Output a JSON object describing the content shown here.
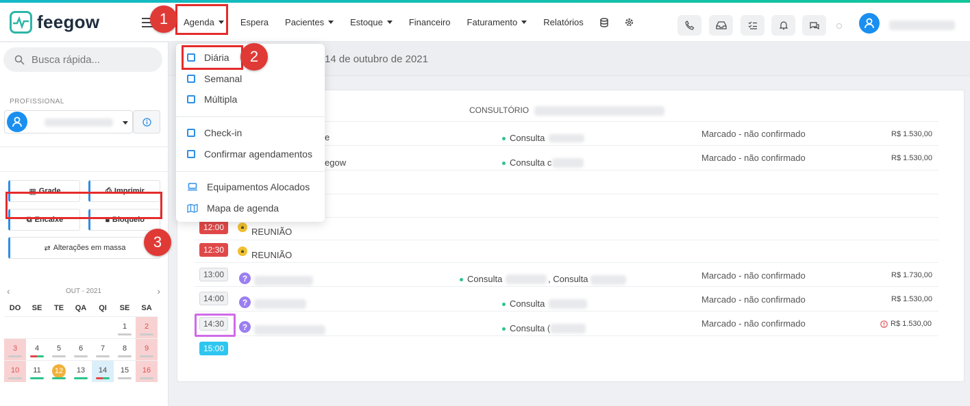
{
  "app": {
    "brand": "feegow"
  },
  "nav": {
    "agenda": "Agenda",
    "espera": "Espera",
    "pacientes": "Pacientes",
    "estoque": "Estoque",
    "financeiro": "Financeiro",
    "faturamento": "Faturamento",
    "relatorios": "Relatórios"
  },
  "badges": {
    "b1": "1",
    "b2": "2",
    "b3": "3"
  },
  "agenda_menu": {
    "items": [
      "Diária",
      "Semanal",
      "Múltipla",
      "Check-in",
      "Confirmar agendamentos",
      "Equipamentos Alocados",
      "Mapa de agenda"
    ]
  },
  "sidebar": {
    "search_placeholder": "Busca rápida...",
    "profissional_label": "PROFISSIONAL",
    "buttons": {
      "grade": "Grade",
      "imprimir": "Imprimir",
      "encaixe": "Encaixe",
      "bloqueio": "Bloqueio",
      "alteracoes": "Alterações em massa"
    }
  },
  "calendar": {
    "month": "OUT - 2021",
    "dow": [
      "DO",
      "SE",
      "TE",
      "QA",
      "QI",
      "SE",
      "SA"
    ],
    "days": [
      "",
      "",
      "",
      "",
      "1",
      "2",
      "3",
      "4",
      "5",
      "6",
      "7",
      "8",
      "9",
      "10",
      "11",
      "12",
      "13",
      "14",
      "15",
      "16"
    ]
  },
  "main": {
    "date_text": "14 de outubro de 2021",
    "room": "CONSULTÓRIO",
    "rows": [
      {
        "time": "",
        "partial_name": "e",
        "service": "Consulta",
        "status": "Marcado - não confirmado",
        "price": "R$ 1.530,00"
      },
      {
        "time": "",
        "partial_name": "egow",
        "service": "Consulta c",
        "status": "Marcado - não confirmado",
        "price": "R$ 1.530,00"
      },
      {
        "time": "12:00",
        "label": "REUNIÃO"
      },
      {
        "time": "12:30",
        "label": "REUNIÃO"
      },
      {
        "time": "13:00",
        "service": "Consulta",
        "service2": ", Consulta",
        "status": "Marcado - não confirmado",
        "price": "R$ 1.730,00"
      },
      {
        "time": "14:00",
        "service": "Consulta",
        "status": "Marcado - não confirmado",
        "price": "R$ 1.530,00"
      },
      {
        "time": "14:30",
        "service": "Consulta (",
        "status": "Marcado - não confirmado",
        "price": "R$ 1.530,00"
      },
      {
        "time": "15:00"
      }
    ]
  }
}
